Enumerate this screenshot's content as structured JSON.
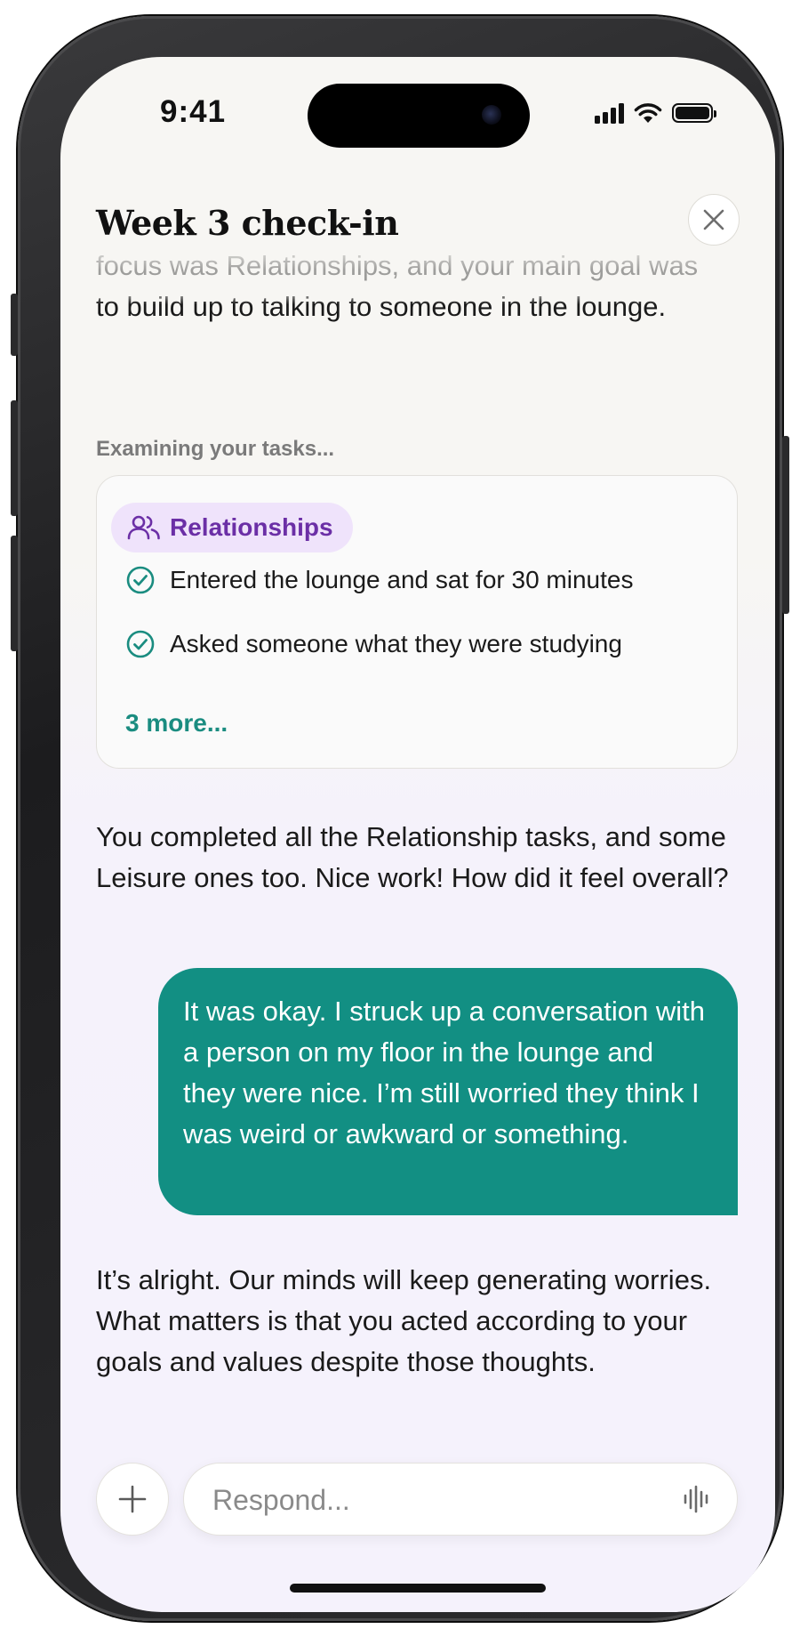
{
  "status_bar": {
    "time": "9:41"
  },
  "header": {
    "title": "Week 3 check-in",
    "close_icon": "close-icon"
  },
  "conversation": {
    "intro_text": "focus was Relationships, and your main goal was to build up to talking to someone in the lounge.",
    "examining_label": "Examining your tasks...",
    "task_card": {
      "category_icon": "people-icon",
      "category_label": "Relationships",
      "tasks": [
        {
          "label": "Entered the lounge and sat for 30 minutes",
          "icon": "check-circle-icon"
        },
        {
          "label": "Asked someone what they were studying",
          "icon": "check-circle-icon"
        }
      ],
      "more_label": "3 more..."
    },
    "ai_message_1": "You completed all the Relationship tasks, and some Leisure ones too. Nice work! How did it feel overall?",
    "user_message": "It was okay. I struck up a conversation with a person on my floor in the lounge and they were nice. I’m still worried they think I was weird or awkward or something.",
    "ai_message_2": "It’s alright. Our minds will keep generating worries. What matters is that you acted according to your goals and values despite those thoughts."
  },
  "composer": {
    "add_icon": "plus-icon",
    "placeholder": "Respond...",
    "voice_icon": "voice-waveform-icon"
  },
  "colors": {
    "accent_teal": "#128f83",
    "category_purple": "#6b2fa6",
    "chip_background": "#efe3fb"
  }
}
